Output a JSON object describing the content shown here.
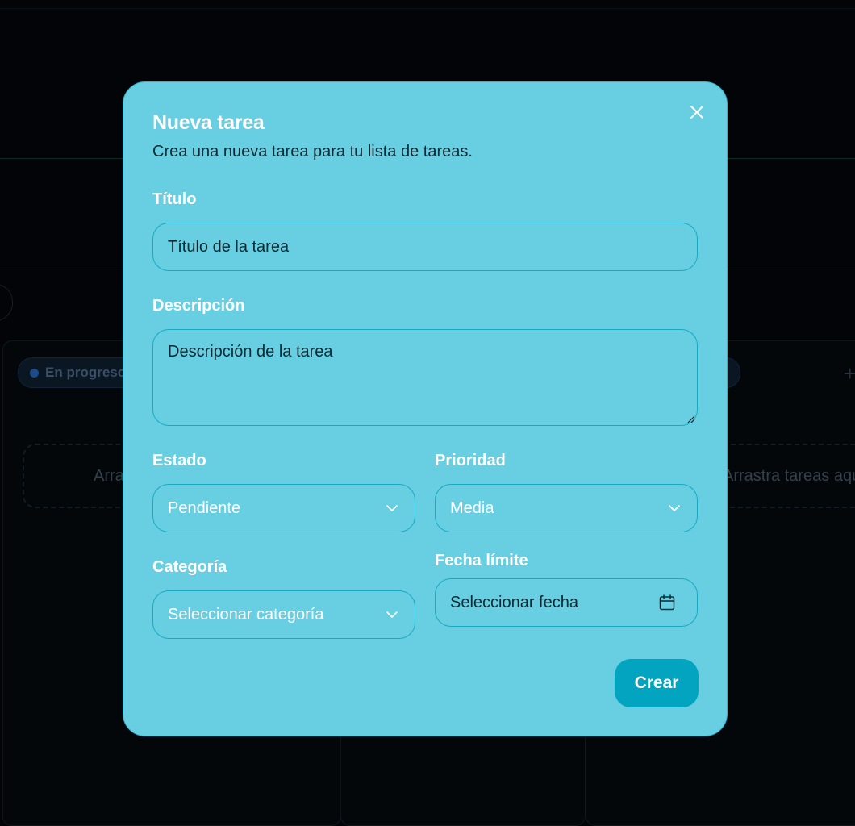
{
  "background": {
    "column_badge": "En progreso",
    "drop_hint_left": "Arrastra tareas aquí",
    "drop_hint_right": "Arrastra tareas aquí",
    "add_icon": "plus-icon"
  },
  "modal": {
    "title": "Nueva tarea",
    "subtitle": "Crea una nueva tarea para tu lista de tareas.",
    "close_icon": "close-icon",
    "fields": {
      "title": {
        "label": "Título",
        "placeholder": "Título de la tarea",
        "value": ""
      },
      "description": {
        "label": "Descripción",
        "placeholder": "Descripción de la tarea",
        "value": ""
      },
      "status": {
        "label": "Estado",
        "value": "Pendiente",
        "icon": "chevron-down-icon"
      },
      "priority": {
        "label": "Prioridad",
        "value": "Media",
        "icon": "chevron-down-icon"
      },
      "category": {
        "label": "Categoría",
        "value": "Seleccionar categoría",
        "icon": "chevron-down-icon"
      },
      "due_date": {
        "label": "Fecha límite",
        "value": "Seleccionar fecha",
        "icon": "calendar-icon"
      }
    },
    "submit_label": "Crear"
  },
  "colors": {
    "modal_bg": "#67cfe1",
    "accent": "#02a4bf",
    "field_border": "#1aa9c3",
    "page_bg": "#020407"
  }
}
